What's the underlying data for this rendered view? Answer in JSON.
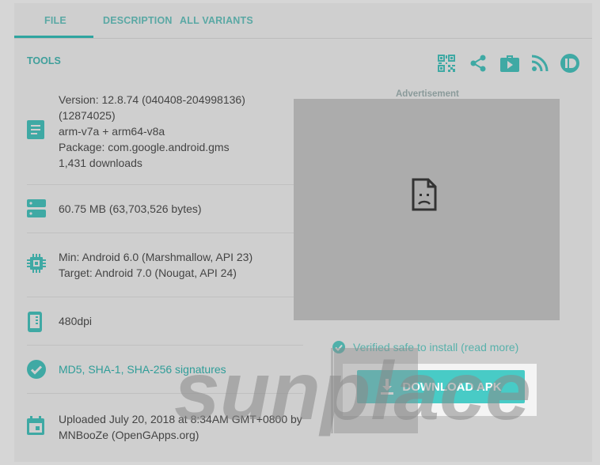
{
  "tabs": [
    {
      "label": "FILE"
    },
    {
      "label": "DESCRIPTION"
    },
    {
      "label": "ALL VARIANTS"
    }
  ],
  "tools": {
    "label": "TOOLS",
    "icons": [
      "qr-code-icon",
      "share-icon",
      "play-store-icon",
      "rss-icon",
      "pushbullet-icon"
    ]
  },
  "colors": {
    "accent": "#2fa5a0",
    "button": "#48cbc6",
    "text": "#444444"
  },
  "file_info": {
    "version_lines": [
      "Version: 12.8.74 (040408-204998136)",
      "(12874025)",
      "arm-v7a + arm64-v8a",
      "Package: com.google.android.gms",
      "1,431 downloads"
    ],
    "size": "60.75 MB (63,703,526 bytes)",
    "sdk_lines": [
      "Min: Android 6.0 (Marshmallow, API 23)",
      "Target: Android 7.0 (Nougat, API 24)"
    ],
    "dpi": "480dpi",
    "signatures": "MD5, SHA-1, SHA-256 signatures",
    "upload_lines": [
      "Uploaded July 20, 2018 at 8:34AM GMT+0800 by",
      "MNBooZe (OpenGApps.org)"
    ]
  },
  "ad": {
    "label": "Advertisement"
  },
  "verified": "Verified safe to install (read more)",
  "download": {
    "label": "DOWNLOAD APK"
  },
  "watermark": "sunplace"
}
